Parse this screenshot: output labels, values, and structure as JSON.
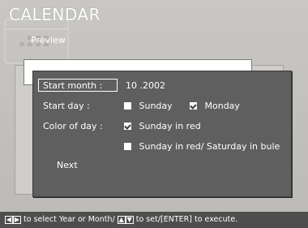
{
  "header": {
    "title": "CALENDAR",
    "subtitle": "Preview"
  },
  "form": {
    "start_month_label": "Start month :",
    "start_month_value": "10 .2002",
    "start_day_label": "Start day :",
    "start_day_options": [
      {
        "label": "Sunday",
        "checked": false
      },
      {
        "label": "Monday",
        "checked": true
      }
    ],
    "color_label": "Color of day :",
    "color_options": [
      {
        "label": "Sunday in red",
        "checked": true
      },
      {
        "label": "Sunday in red/ Saturday in bule",
        "checked": false
      }
    ],
    "next_label": "Next"
  },
  "help": {
    "text_1": "to select Year or Month/",
    "text_2": "to set/[ENTER] to execute."
  }
}
